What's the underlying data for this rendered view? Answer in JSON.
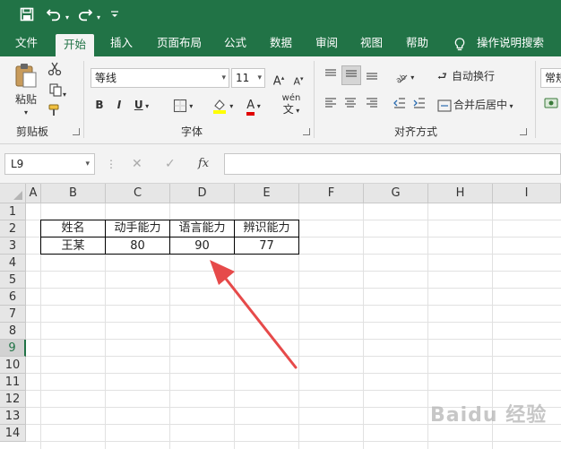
{
  "qat": {
    "save_icon": "save-icon",
    "undo_icon": "undo-icon",
    "redo_icon": "redo-icon",
    "customize_icon": "customize-qat-icon"
  },
  "tabs": [
    {
      "label": "文件"
    },
    {
      "label": "开始"
    },
    {
      "label": "插入"
    },
    {
      "label": "页面布局"
    },
    {
      "label": "公式"
    },
    {
      "label": "数据"
    },
    {
      "label": "审阅"
    },
    {
      "label": "视图"
    },
    {
      "label": "帮助"
    },
    {
      "label": "操作说明搜索"
    }
  ],
  "ribbon": {
    "paste_label": "粘贴",
    "clipboard_group": "剪贴板",
    "font_name": "等线",
    "font_size": "11",
    "font_group": "字体",
    "bold": "B",
    "italic": "I",
    "underline": "U",
    "font_color_letter": "A",
    "phonetic": "wén",
    "wrap_text": "自动换行",
    "merge_center": "合并后居中",
    "alignment_group": "对齐方式",
    "number_format": "常规"
  },
  "formula_bar": {
    "name_box": "L9",
    "fx_label": "fx",
    "formula_value": ""
  },
  "sheet": {
    "columns": [
      "A",
      "B",
      "C",
      "D",
      "E",
      "F",
      "G",
      "H",
      "I"
    ],
    "rows": [
      "1",
      "2",
      "3",
      "4",
      "5",
      "6",
      "7",
      "8",
      "9",
      "10",
      "11",
      "12",
      "13",
      "14"
    ],
    "selected_row": "9",
    "table": {
      "headers": [
        "姓名",
        "动手能力",
        "语言能力",
        "辨识能力"
      ],
      "values": [
        "王某",
        "80",
        "90",
        "77"
      ]
    }
  },
  "colors": {
    "excel_green": "#217346",
    "arrow": "#e64a4a"
  },
  "watermark": "Baidu 经验"
}
